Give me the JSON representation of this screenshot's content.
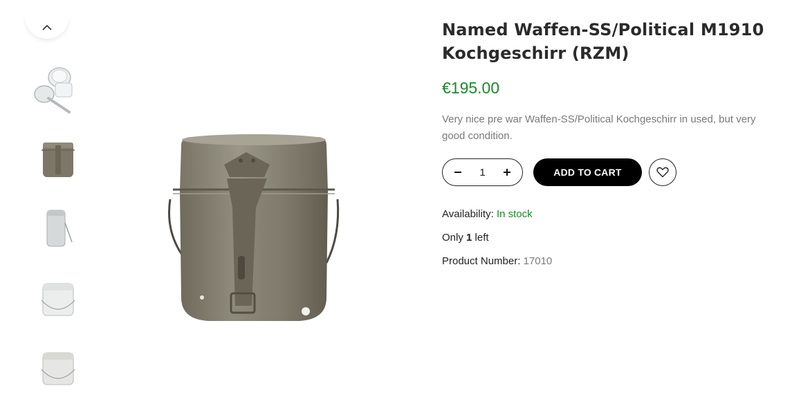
{
  "gallery": {
    "thumbnails": [
      {
        "name": "thumb-mess-kit-open-set"
      },
      {
        "name": "thumb-mess-kit-front"
      },
      {
        "name": "thumb-mess-kit-side"
      },
      {
        "name": "thumb-mess-kit-white"
      },
      {
        "name": "thumb-mess-kit-white-2"
      }
    ]
  },
  "product": {
    "title": "Named Waffen-SS/Political M1910 Kochgeschirr (RZM)",
    "price": "€195.00",
    "description": "Very nice pre war Waffen-SS/Political Kochgeschirr in used, but very good condition.",
    "quantity": "1",
    "add_to_cart_label": "ADD TO CART",
    "availability_label": "Availability:",
    "availability_value": "In stock",
    "stock_prefix": "Only",
    "stock_count": "1",
    "stock_suffix": "left",
    "product_number_label": "Product Number:",
    "product_number_value": "17010"
  },
  "colors": {
    "price": "#1a8a2a",
    "button": "#000000"
  }
}
